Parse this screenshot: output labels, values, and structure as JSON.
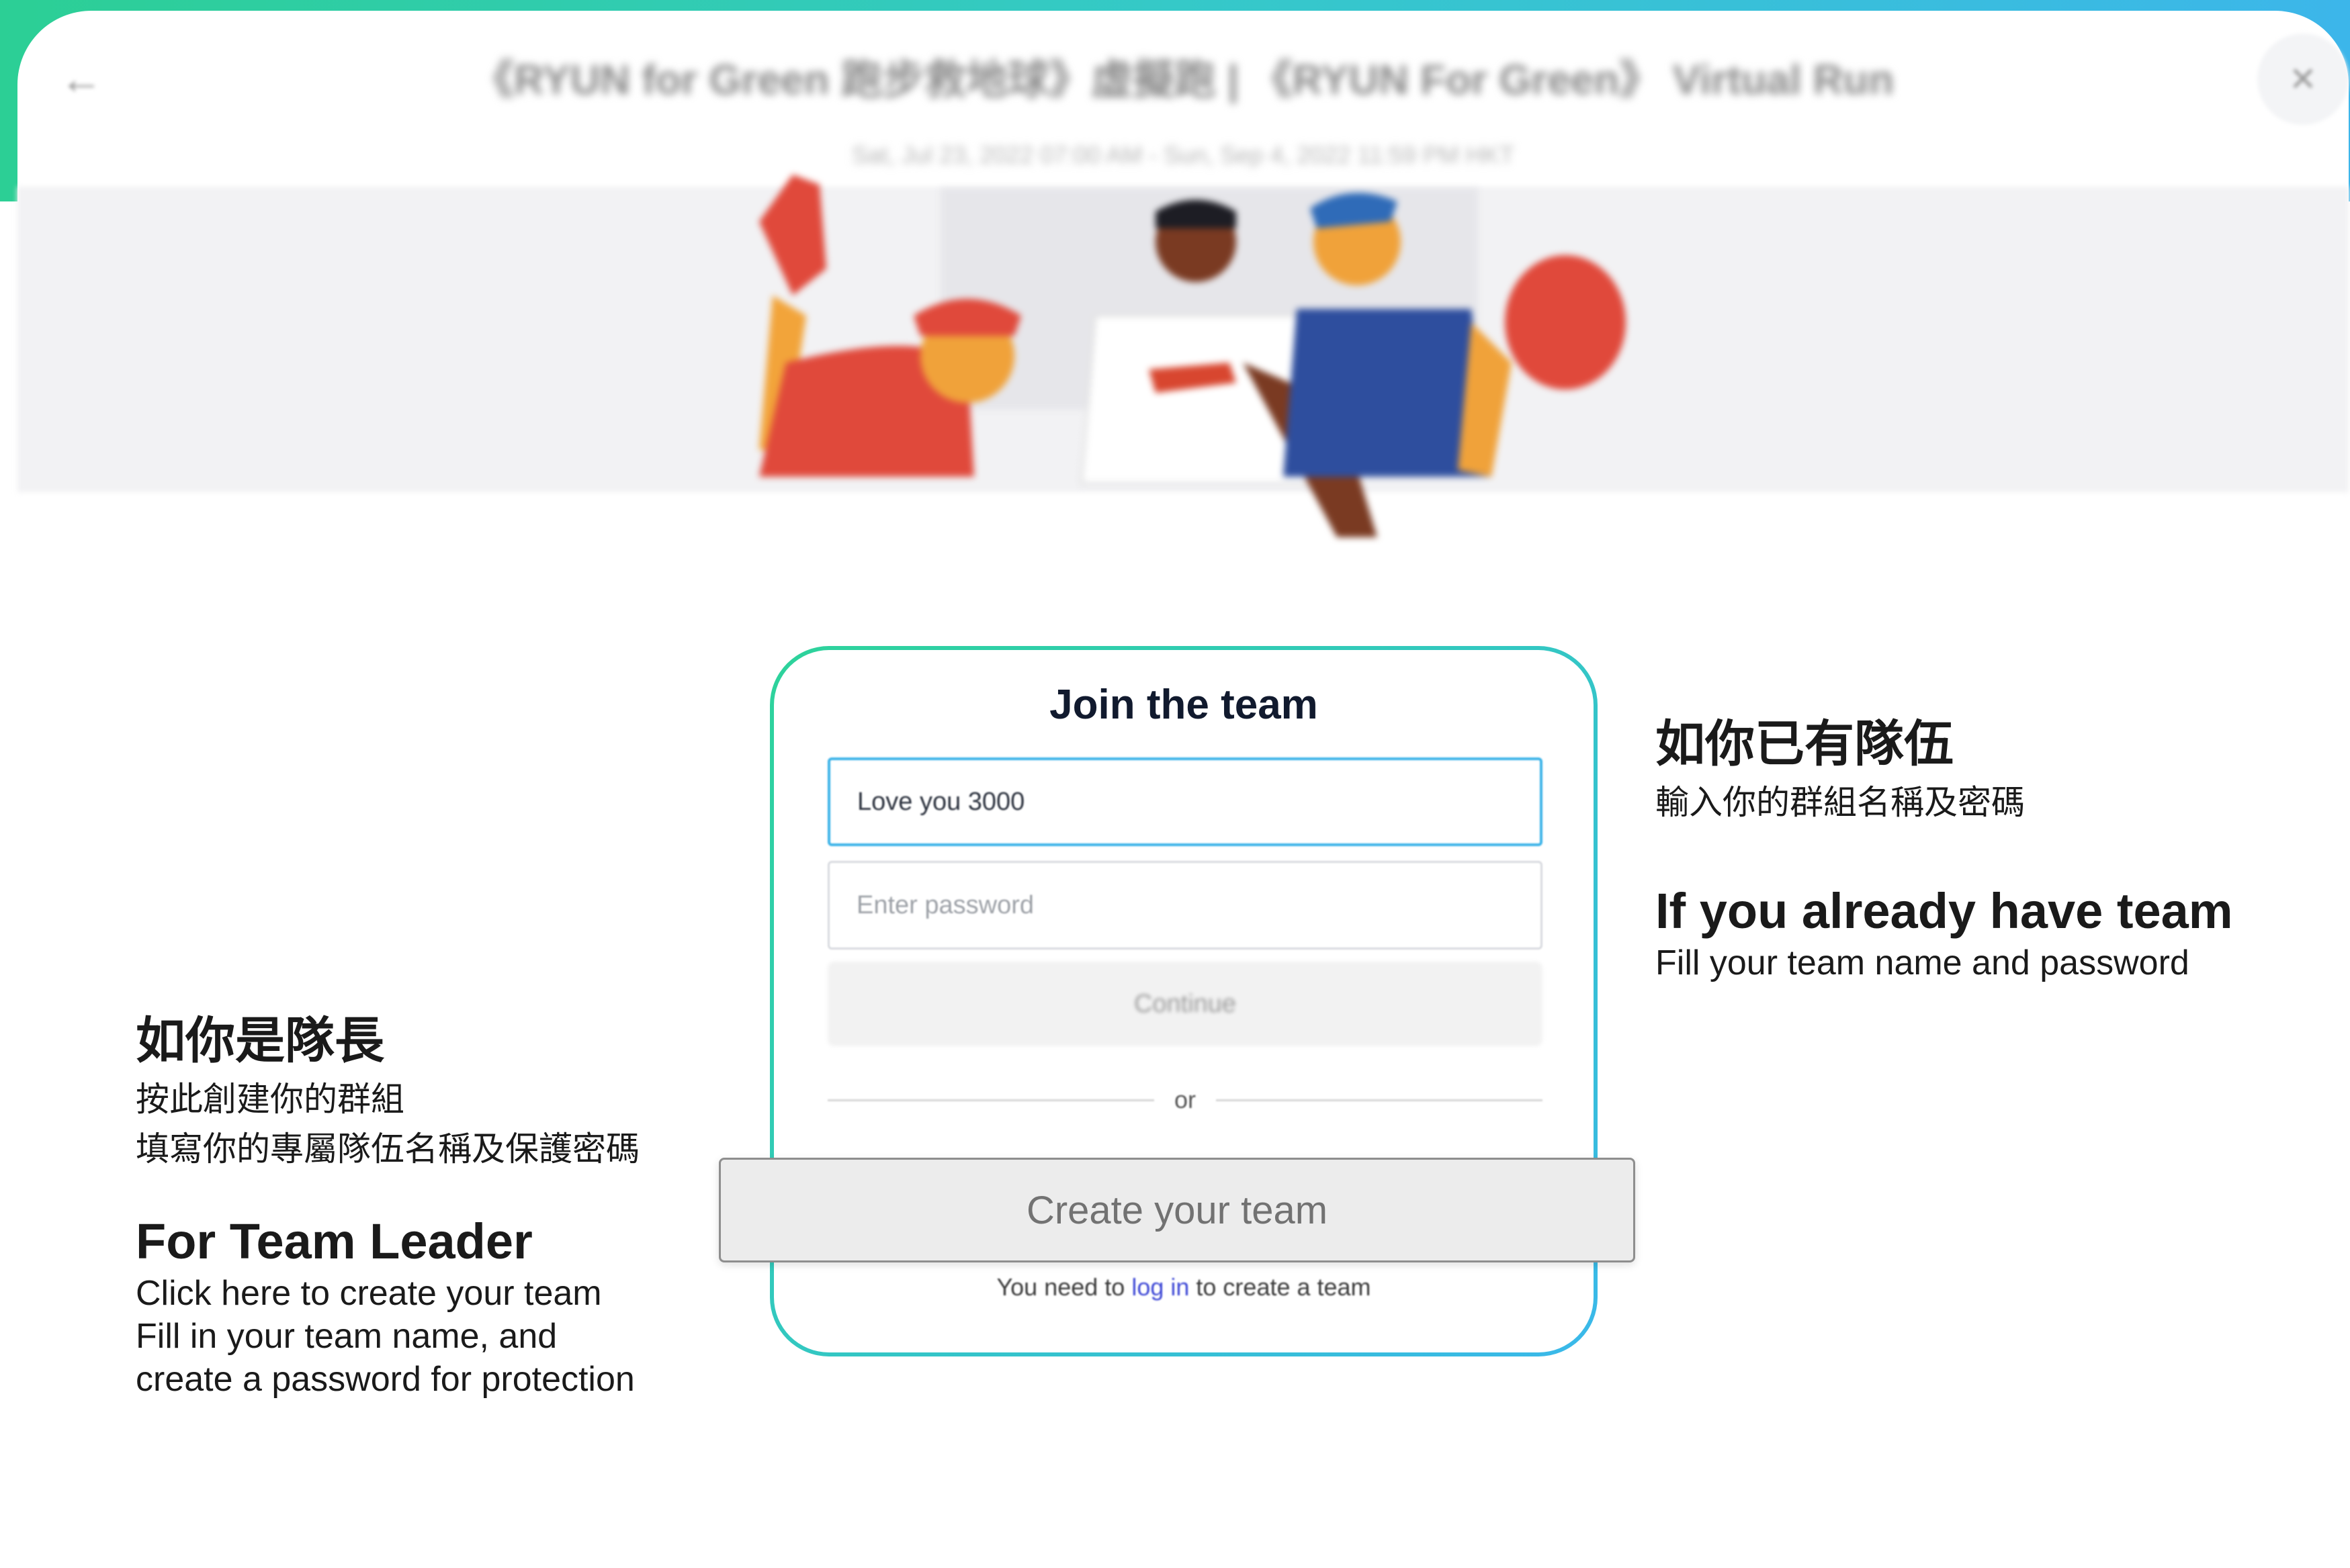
{
  "header": {
    "back_icon": "arrow-left-icon",
    "close_icon": "close-icon",
    "title": "《RYUN for Green 跑步救地球》虛擬跑 | 《RYUN For Green》 Virtual Run",
    "date": "Sat, Jul 23, 2022 07:00 AM - Sun, Sep 4, 2022 11:59 PM HKT"
  },
  "join_form": {
    "title": "Join the team",
    "team_name_value": "Love you 3000",
    "password_placeholder": "Enter password",
    "continue_label": "Continue",
    "or_label": "or",
    "create_label": "Create your team",
    "login_note_prefix": "You need to",
    "login_link": "log in",
    "login_note_suffix": "to create a team"
  },
  "leader_note": {
    "zh_title": "如你是隊長",
    "zh_line1": "按此創建你的群組",
    "zh_line2": "填寫你的專屬隊伍名稱及保護密碼",
    "en_title": "For Team Leader",
    "en_line1": "Click here to create your team",
    "en_line2": "Fill in your team name, and",
    "en_line3": "create a password for protection"
  },
  "member_note": {
    "zh_title": "如你已有隊伍",
    "zh_line1": "輸入你的群組名稱及密碼",
    "en_title": "If you already have team",
    "en_line1": "Fill your team name and password"
  },
  "colors": {
    "accent_green": "#2dd39a",
    "accent_blue": "#3ab8ea",
    "link": "#3f49d6"
  }
}
